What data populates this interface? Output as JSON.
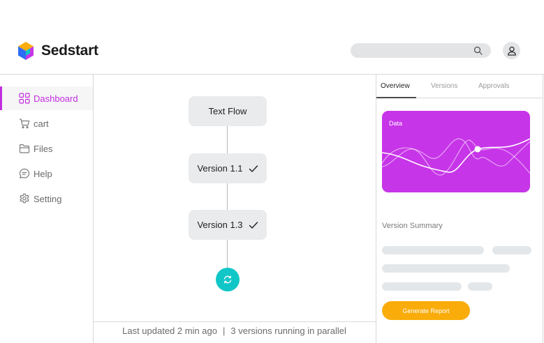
{
  "brand": {
    "name": "Sedstart",
    "logo_colors": [
      "#f9ac0a",
      "#c735e8",
      "#11c6c6",
      "#2f6cf6"
    ]
  },
  "search": {
    "value": "",
    "placeholder": "",
    "icon": "search-icon"
  },
  "user": {
    "icon": "user-icon"
  },
  "sidebar": {
    "items": [
      {
        "label": "Dashboard",
        "icon": "dashboard-grid-icon",
        "active": true
      },
      {
        "label": "cart",
        "icon": "cart-icon",
        "active": false
      },
      {
        "label": "Files",
        "icon": "folder-icon",
        "active": false
      },
      {
        "label": "Help",
        "icon": "chat-bubble-icon",
        "active": false
      },
      {
        "label": "Setting",
        "icon": "gear-icon",
        "active": false
      }
    ]
  },
  "flow": {
    "nodes": [
      {
        "label": "Text Flow",
        "checked": false
      },
      {
        "label": "Version 1.1",
        "checked": true
      },
      {
        "label": "Version 1.3",
        "checked": true
      }
    ],
    "end_icon": "sync-icon"
  },
  "footer": {
    "updated": "Last updated 2 min ago",
    "separator": "|",
    "running": "3 versions running in parallel"
  },
  "panel": {
    "tabs": [
      {
        "label": "Overview",
        "active": true
      },
      {
        "label": "Versions",
        "active": false
      },
      {
        "label": "Approvals",
        "active": false
      }
    ],
    "data_card": {
      "label": "Data"
    },
    "summary_title": "Version Summary",
    "generate_button": "Generate Report"
  },
  "colors": {
    "accent": "#c12ee0",
    "card": "#c735e8",
    "teal": "#11c6c6",
    "button": "#f9ac0a"
  }
}
